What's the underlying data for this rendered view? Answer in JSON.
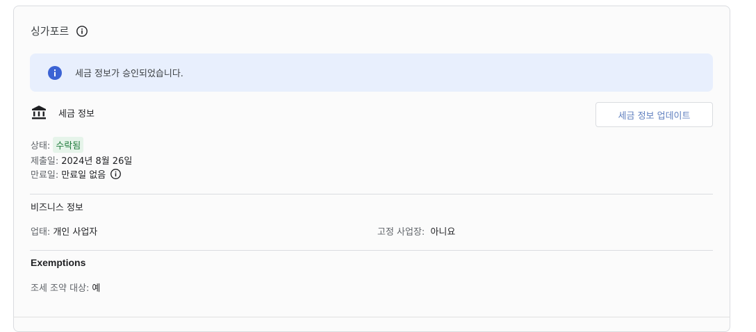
{
  "region": {
    "title": "싱가포르",
    "title_icon": "info-outline-icon"
  },
  "banner": {
    "icon": "info-filled-icon",
    "text": "세금 정보가 승인되었습니다.",
    "background": "#e8effd",
    "icon_color": "#3b63d4"
  },
  "tax_info": {
    "icon": "bank-icon",
    "title": "세금 정보",
    "update_button": "세금 정보 업데이트",
    "status_label": "상태:",
    "status_value": "수락됨",
    "status_color": "#1e7a3a",
    "submitted_label": "제출일:",
    "submitted_value": "2024년 8월 26일",
    "expiry_label": "만료일:",
    "expiry_value": "만료일 없음",
    "expiry_icon": "info-outline-icon"
  },
  "business_info": {
    "title": "비즈니스 정보",
    "type_label": "업태:",
    "type_value": "개인 사업자",
    "fixed_label": "고정 사업장:",
    "fixed_value": "아니요"
  },
  "exemptions": {
    "title": "Exemptions",
    "treaty_label": "조세 조약 대상:",
    "treaty_value": "예"
  }
}
